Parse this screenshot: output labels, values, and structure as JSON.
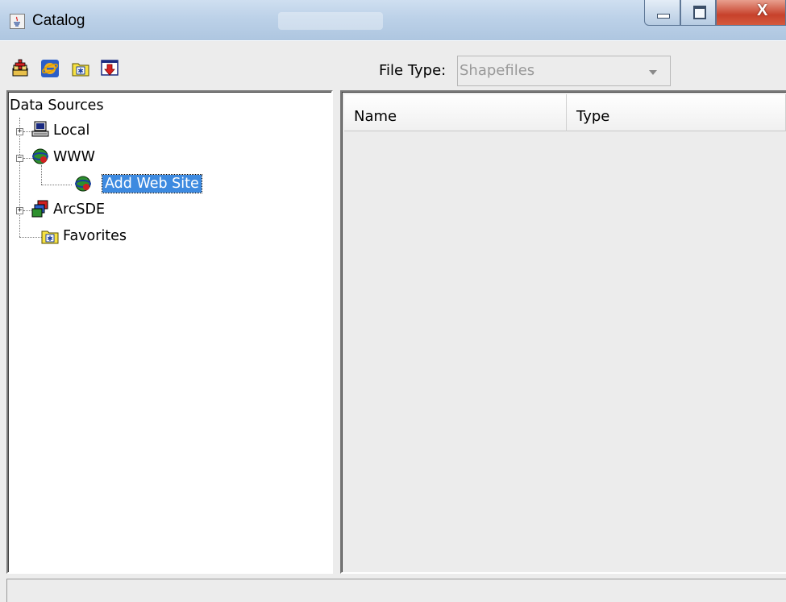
{
  "window": {
    "title": "Catalog",
    "icon": "java-app-icon",
    "controls": [
      "minimize-icon",
      "maximize-icon",
      "close-icon"
    ],
    "close_glyph": "X"
  },
  "toolbar": {
    "buttons": [
      {
        "name": "add-data-icon"
      },
      {
        "name": "internet-explorer-icon"
      },
      {
        "name": "favorites-folder-icon"
      },
      {
        "name": "download-icon"
      }
    ],
    "file_type_label": "File Type:",
    "file_type_value": "Shapefiles"
  },
  "tree": {
    "root_label": "Data Sources",
    "nodes": [
      {
        "label": "Local",
        "icon": "computer-icon",
        "expander": "+"
      },
      {
        "label": "WWW",
        "icon": "globe-icon",
        "expander": "−"
      },
      {
        "label": "Add Web Site",
        "icon": "globe-icon",
        "selected": true
      },
      {
        "label": "ArcSDE",
        "icon": "database-server-icon",
        "expander": "+"
      },
      {
        "label": "Favorites",
        "icon": "favorites-folder-icon"
      }
    ]
  },
  "list": {
    "columns": [
      "Name",
      "Type"
    ]
  },
  "colors": {
    "selection": "#3d8ae0",
    "background": "#ececec",
    "close_button": "#c7412b"
  }
}
